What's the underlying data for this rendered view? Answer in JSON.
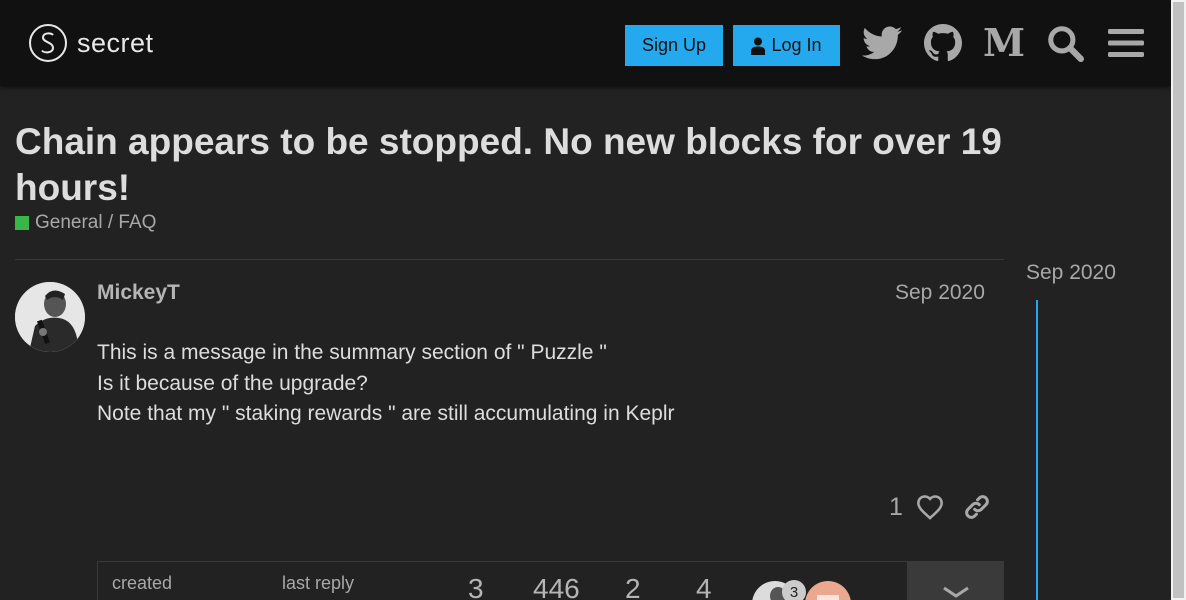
{
  "header": {
    "logo_text": "secret",
    "signup_label": "Sign Up",
    "login_label": "Log In",
    "icons": [
      "twitter-icon",
      "github-icon",
      "medium-icon",
      "search-icon",
      "hamburger-menu-icon"
    ]
  },
  "topic": {
    "title": "Chain appears to be stopped. No new blocks for over 19 hours!",
    "category": "General / FAQ",
    "category_color": "#3ab54a"
  },
  "post": {
    "username": "MickeyT",
    "date": "Sep 2020",
    "lines": [
      "This is a message in the summary section of \" Puzzle \"",
      "Is it because of the upgrade?",
      "Note that my \" staking rewards \" are still accumulating in Keplr"
    ],
    "like_count": "1"
  },
  "summary": {
    "created_label": "created",
    "last_reply_label": "last reply",
    "replies": "3",
    "views": "446",
    "users": "2",
    "likes": "4",
    "avatar_badge": "3"
  },
  "timeline": {
    "date": "Sep 2020"
  },
  "colors": {
    "accent": "#24a8ee",
    "background": "#222222",
    "header_bg": "#111111"
  }
}
